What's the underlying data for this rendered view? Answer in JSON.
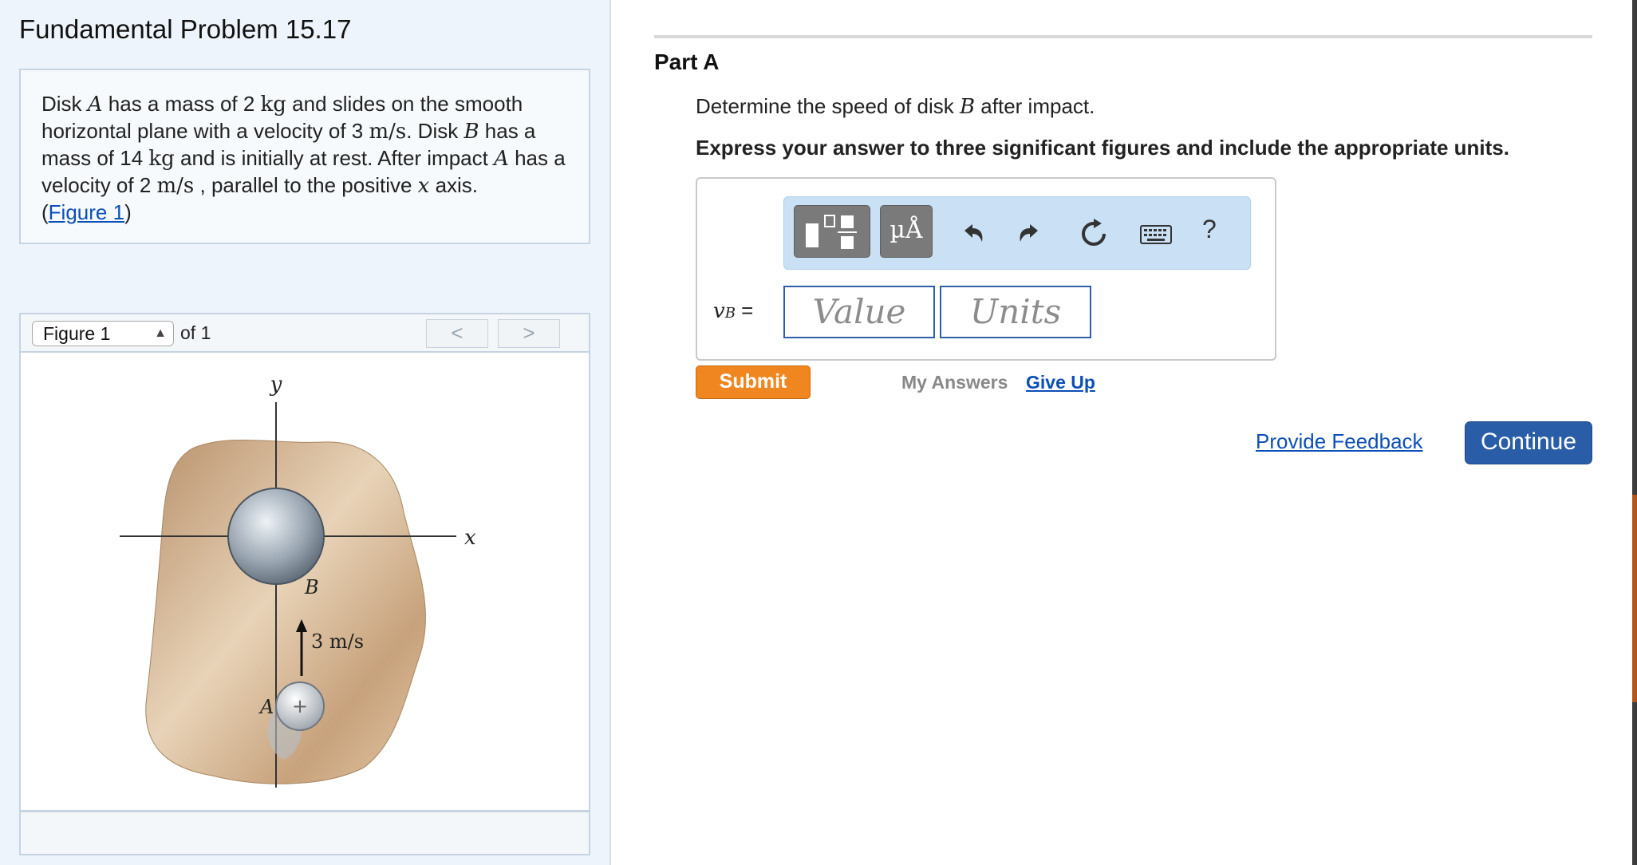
{
  "problem": {
    "title": "Fundamental Problem 15.17",
    "text": {
      "t1": "Disk ",
      "A1": "A",
      "t2": " has a mass of 2 ",
      "u_kg1": "kg",
      "t3": " and slides on the smooth horizontal plane with a velocity of 3 ",
      "u_ms1": "m/s",
      "t4": ". Disk ",
      "B1": "B",
      "t5": " has a mass of 14 ",
      "u_kg2": "kg",
      "t6": " and is initially at rest. After impact ",
      "A2": "A",
      "t7": " has a velocity of 2 ",
      "u_ms2": "m/s",
      "t8": " , parallel to the positive ",
      "x1": "x",
      "t9": " axis.",
      "open": "(",
      "figure_link": "Figure 1",
      "close": ")"
    }
  },
  "figure_nav": {
    "selected": "Figure 1",
    "of_label": "of 1",
    "prev": "<",
    "next": ">"
  },
  "figure": {
    "y_label": "y",
    "x_label": "x",
    "b_label": "B",
    "a_label": "A",
    "velocity_label": "3 m/s"
  },
  "part": {
    "title": "Part A",
    "question_prefix": "Determine the speed of disk ",
    "question_var": "B",
    "question_suffix": " after impact.",
    "instructions": "Express your answer to three significant figures and include the appropriate units."
  },
  "toolbar": {
    "icons": [
      "templates-icon",
      "units-symbols-icon",
      "undo-icon",
      "redo-icon",
      "reset-icon",
      "keyboard-icon",
      "help-icon"
    ],
    "mu_label": "µÅ",
    "help_label": "?"
  },
  "answer": {
    "var": "v",
    "sub": "B",
    "eq": "=",
    "value_placeholder": "Value",
    "units_placeholder": "Units"
  },
  "actions": {
    "submit": "Submit",
    "my_answers": "My Answers",
    "give_up": "Give Up",
    "provide_feedback": "Provide Feedback",
    "continue": "Continue"
  },
  "colors": {
    "accent_orange": "#f0861f",
    "accent_blue": "#2a5da8",
    "link_blue": "#0b4fb8",
    "left_pane_bg": "#eef4fb"
  }
}
